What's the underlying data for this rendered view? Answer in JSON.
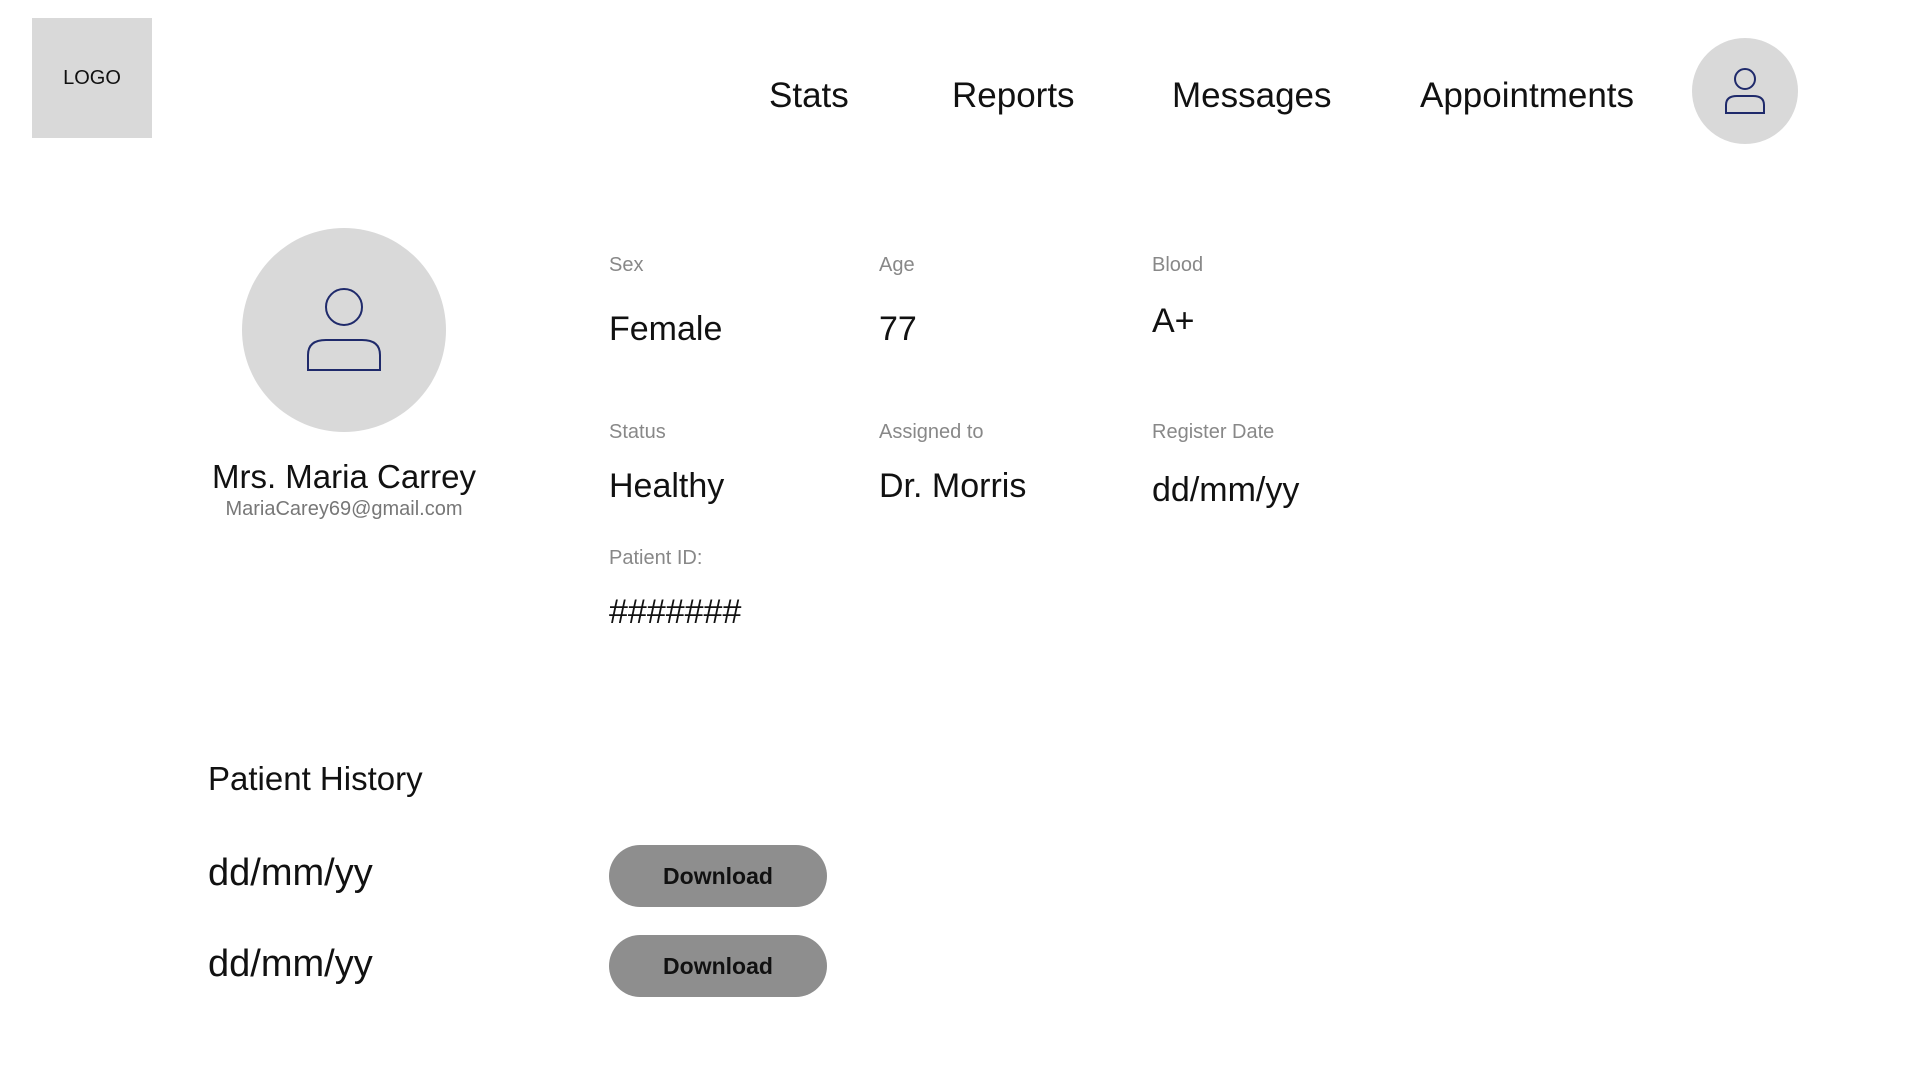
{
  "header": {
    "logo_text": "LOGO",
    "nav": [
      {
        "label": "Stats"
      },
      {
        "label": "Reports"
      },
      {
        "label": "Messages"
      },
      {
        "label": "Appointments"
      }
    ],
    "user_icon": "user-icon"
  },
  "patient": {
    "avatar_icon": "user-icon",
    "name": "Mrs. Maria Carrey",
    "email": "MariaCarey69@gmail.com",
    "fields": {
      "sex": {
        "label": "Sex",
        "value": "Female"
      },
      "age": {
        "label": "Age",
        "value": "77"
      },
      "blood": {
        "label": "Blood",
        "value": "A+"
      },
      "status": {
        "label": "Status",
        "value": "Healthy"
      },
      "assigned": {
        "label": "Assigned to",
        "value": "Dr. Morris"
      },
      "register": {
        "label": "Register Date",
        "value": "dd/mm/yy"
      },
      "patient_id": {
        "label": "Patient ID:",
        "value": "#######"
      }
    }
  },
  "history": {
    "title": "Patient History",
    "entries": [
      {
        "date": "dd/mm/yy",
        "button_label": "Download"
      },
      {
        "date": "dd/mm/yy",
        "button_label": "Download"
      }
    ]
  },
  "colors": {
    "placeholder_gray": "#d9d9d9",
    "button_gray": "#8e8e8e",
    "icon_stroke": "#1f2a6b",
    "label_gray": "#888888"
  }
}
